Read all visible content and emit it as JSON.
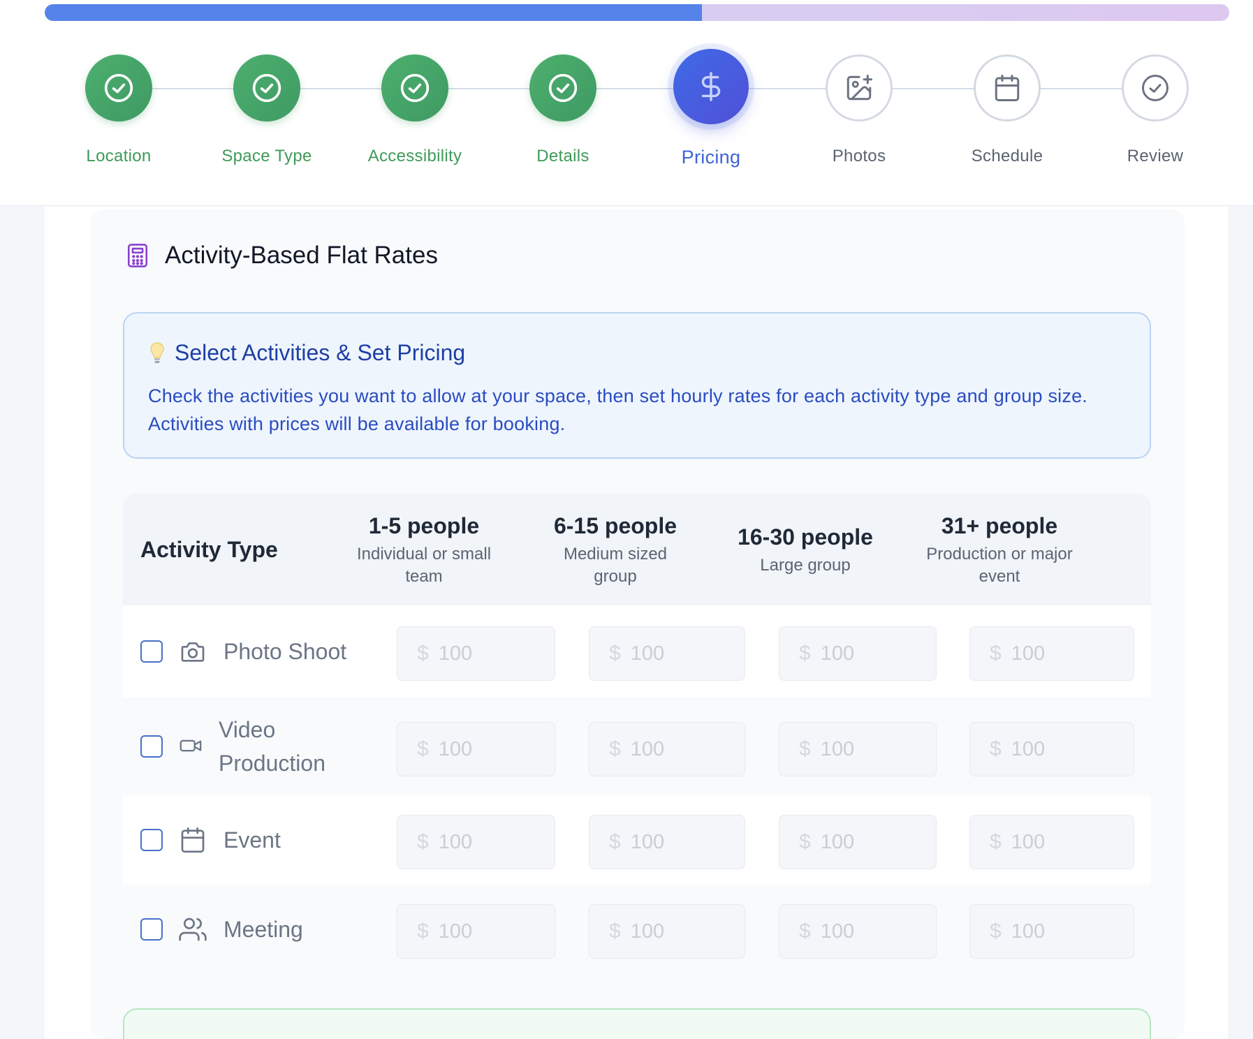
{
  "progress": {
    "fraction": 0.555
  },
  "steps": [
    {
      "label": "Location",
      "state": "done",
      "icon": "check-circle-icon"
    },
    {
      "label": "Space Type",
      "state": "done",
      "icon": "check-circle-icon"
    },
    {
      "label": "Accessibility",
      "state": "done",
      "icon": "check-circle-icon"
    },
    {
      "label": "Details",
      "state": "done",
      "icon": "check-circle-icon"
    },
    {
      "label": "Pricing",
      "state": "active",
      "icon": "dollar-icon"
    },
    {
      "label": "Photos",
      "state": "todo",
      "icon": "image-plus-icon"
    },
    {
      "label": "Schedule",
      "state": "todo",
      "icon": "calendar-icon"
    },
    {
      "label": "Review",
      "state": "todo",
      "icon": "check-circle-icon"
    }
  ],
  "section": {
    "title": "Activity-Based Flat Rates",
    "icon": "calculator-icon"
  },
  "info": {
    "icon": "lightbulb-icon",
    "title": "Select Activities & Set Pricing",
    "text": "Check the activities you want to allow at your space, then set hourly rates for each activity type and group size. Activities with prices will be available for booking."
  },
  "table": {
    "activity_header": "Activity Type",
    "columns": [
      {
        "heading": "1-5 people",
        "sub": "Individual or small team"
      },
      {
        "heading": "6-15 people",
        "sub": "Medium sized group"
      },
      {
        "heading": "16-30 people",
        "sub": "Large group"
      },
      {
        "heading": "31+ people",
        "sub": "Production or major event"
      }
    ],
    "rows": [
      {
        "label": "Photo Shoot",
        "icon": "camera-icon",
        "checked": false,
        "placeholders": [
          "100",
          "100",
          "100",
          "100"
        ]
      },
      {
        "label": "Video Production",
        "icon": "video-icon",
        "checked": false,
        "placeholders": [
          "100",
          "100",
          "100",
          "100"
        ]
      },
      {
        "label": "Event",
        "icon": "calendar-icon",
        "checked": false,
        "placeholders": [
          "100",
          "100",
          "100",
          "100"
        ]
      },
      {
        "label": "Meeting",
        "icon": "users-icon",
        "checked": false,
        "placeholders": [
          "100",
          "100",
          "100",
          "100"
        ]
      }
    ],
    "currency_symbol": "$"
  },
  "colors": {
    "done": "#3f9a59",
    "active": "#3f63d8",
    "todo": "#5a6372",
    "accent_purple": "#8b3fd0"
  }
}
